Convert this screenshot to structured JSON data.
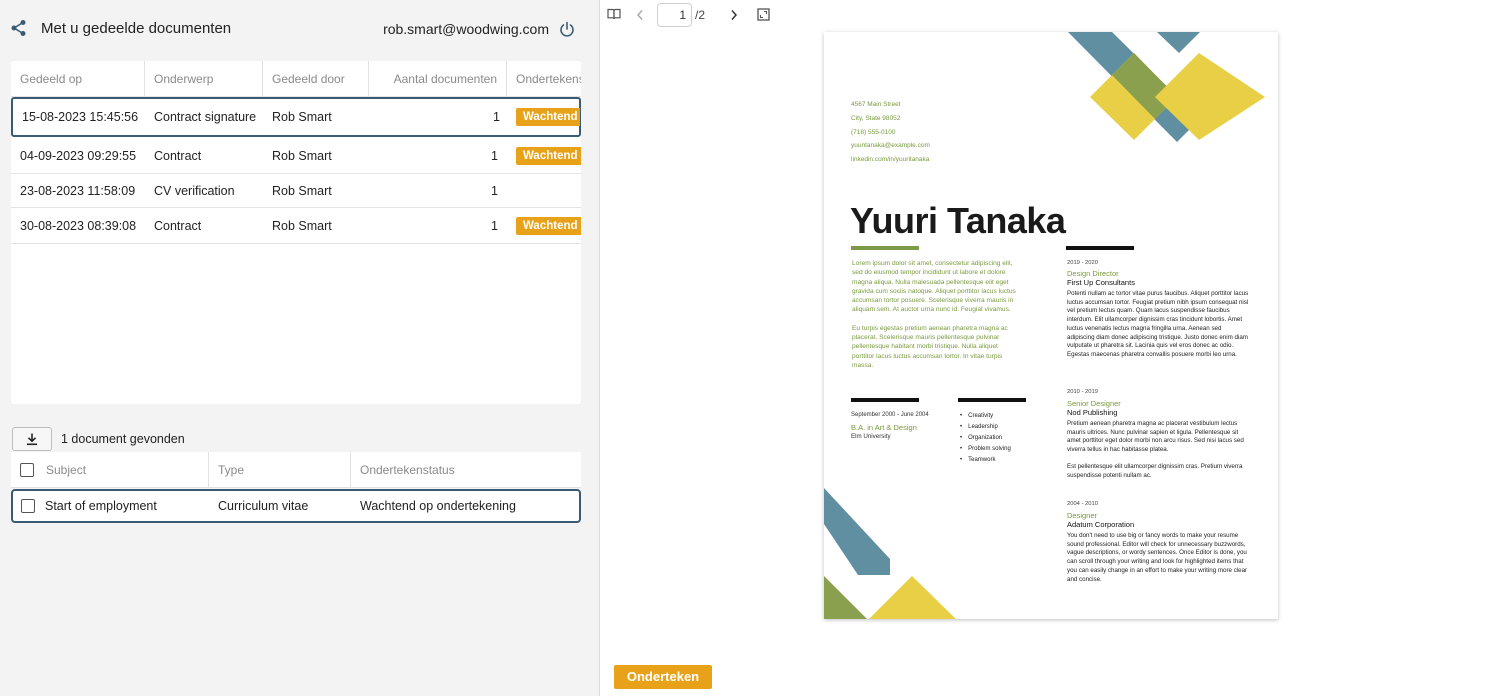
{
  "header": {
    "title": "Met u gedeelde documenten",
    "user_email": "rob.smart@woodwing.com"
  },
  "shared_table": {
    "columns": [
      "Gedeeld op",
      "Onderwerp",
      "Gedeeld door",
      "Aantal documenten",
      "Ondertekens"
    ],
    "rows": [
      {
        "date": "15-08-2023 15:45:56",
        "subject": "Contract signature",
        "shared_by": "Rob Smart",
        "count": "1",
        "status": "Wachtend op"
      },
      {
        "date": "04-09-2023 09:29:55",
        "subject": "Contract",
        "shared_by": "Rob Smart",
        "count": "1",
        "status": "Wachtend op"
      },
      {
        "date": "23-08-2023 11:58:09",
        "subject": "CV verification",
        "shared_by": "Rob Smart",
        "count": "1",
        "status": ""
      },
      {
        "date": "30-08-2023 08:39:08",
        "subject": "Contract",
        "shared_by": "Rob Smart",
        "count": "1",
        "status": "Wachtend op"
      }
    ]
  },
  "documents": {
    "found_text": "1 document gevonden",
    "columns": [
      "Subject",
      "Type",
      "Ondertekenstatus"
    ],
    "rows": [
      {
        "subject": "Start of employment",
        "type": "Curriculum vitae",
        "status": "Wachtend op ondertekening"
      }
    ]
  },
  "viewer": {
    "page_current": "1",
    "page_total": "/2",
    "sign_label": "Onderteken"
  },
  "resume": {
    "contact": [
      "4567 Main Street",
      "City, State 98052",
      "(718) 555-0100",
      "yuuntanaka@example.com",
      "linkedin.com/in/yuuritanaka"
    ],
    "name": "Yuuri Tanaka",
    "intro_1": "Lorem ipsum dolor sit amet, consectetur adipiscing elit, sed do eiusmod tempor incididunt ut labore et dolore magna aliqua. Nulla malesuada pellentesque elit eget gravida cum sociis natoque. Aliquet porttitor lacus luctus accumsan tortor posuere. Scelerisque viverra mauris in aliquam sem. At auctor urna nunc id. Feugiat vivamus.",
    "intro_2": "Eu turpis egestas pretium aenean pharetra magna ac placerat. Scelerisque mauris pellentesque pulvinar pellentesque habitant morbi tristique. Nulla aliquet porttitor lacus luctus accumsan tortor. In vitae turpis massa.",
    "education": {
      "dates": "September 2000 - June 2004",
      "degree": "B.A. in Art & Design",
      "school": "Elm University"
    },
    "skills": [
      "Creativity",
      "Leadership",
      "Organization",
      "Problem solving",
      "Teamwork"
    ],
    "jobs": [
      {
        "dates": "2019 - 2020",
        "title": "Design Director",
        "company": "First Up Consultants",
        "desc": "Potenti nullam ac tortor vitae purus faucibus. Aliquet porttitor lacus luctus accumsan tortor. Feugiat pretium nibh ipsum consequat nisl vel pretium lectus quam. Quam lacus suspendisse faucibus interdum. Elit ullamcorper dignissim cras tincidunt lobortis. Amet luctus venenatis lectus magna fringilla urna. Aenean sed adipiscing diam donec adipiscing tristique. Justo donec enim diam vulputate ut pharetra sit. Lacinia quis vel eros donec ac odio. Egestas maecenas pharetra convallis posuere morbi leo urna."
      },
      {
        "dates": "2010 - 2019",
        "title": "Senior Designer",
        "company": "Nod Publishing",
        "desc": "Pretium aenean pharetra magna ac placerat vestibulum lectus mauris ultrices. Nunc pulvinar sapien et ligula. Pellentesque sit amet porttitor eget dolor morbi non arcu risus. Sed nisi lacus sed viverra tellus in hac habitasse platea.",
        "desc2": "Est pellentesque elit ullamcorper dignissim cras. Pretium viverra suspendisse potenti nullam ac."
      },
      {
        "dates": "2004 - 2010",
        "title": "Designer",
        "company": "Adatum Corporation",
        "desc": "You don't need to use big or fancy words to make your resume sound professional. Editor will check for unnecessary buzzwords, vague descriptions, or wordy sentences. Once Editor is done, you can scroll through your writing and look for highlighted items that you can easily change in an effort to make your writing more clear and concise."
      }
    ]
  },
  "colors": {
    "accent": "#e8a219",
    "selected_border": "#3b5a73",
    "resume_green": "#7d9a48",
    "resume_blue": "#5f8fa0",
    "resume_yellow": "#e9cf45"
  }
}
